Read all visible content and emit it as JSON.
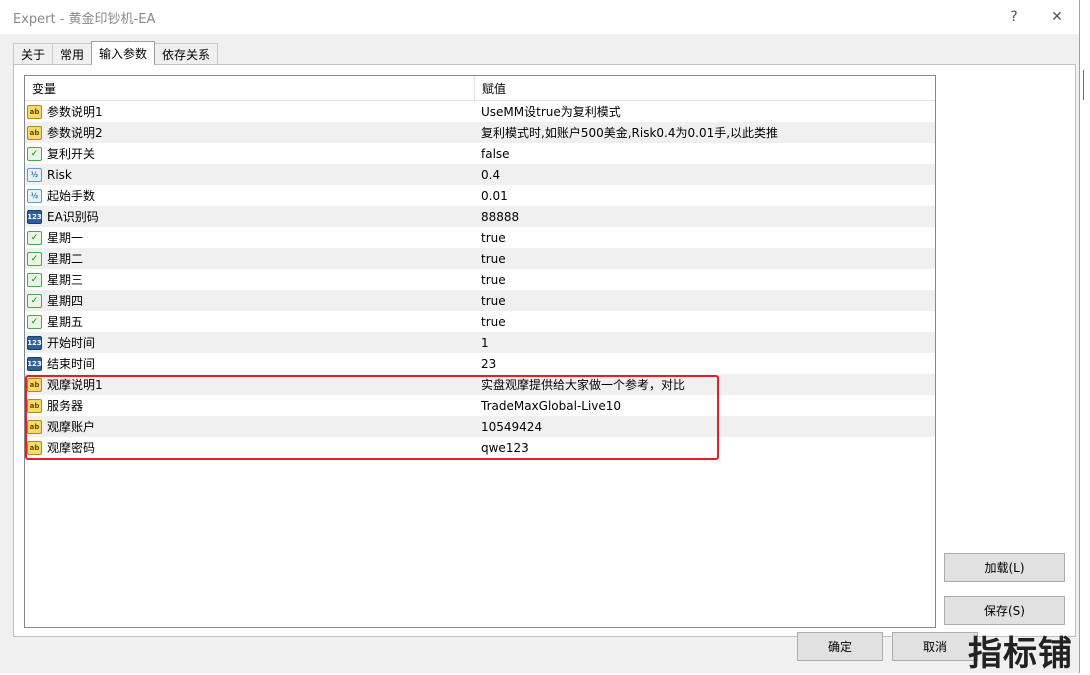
{
  "window": {
    "title": "Expert - 黄金印钞机-EA",
    "help_glyph": "?",
    "close_glyph": "✕"
  },
  "tabs": [
    {
      "label": "关于",
      "active": false
    },
    {
      "label": "常用",
      "active": false
    },
    {
      "label": "输入参数",
      "active": true
    },
    {
      "label": "依存关系",
      "active": false
    }
  ],
  "grid": {
    "headers": {
      "variable": "变量",
      "value": "赋值"
    },
    "rows": [
      {
        "icon": "ab",
        "name": "参数说明1",
        "value": "UseMM设true为复利模式"
      },
      {
        "icon": "ab",
        "name": "参数说明2",
        "value": "复利模式时,如账户500美金,Risk0.4为0.01手,以此类推"
      },
      {
        "icon": "bool",
        "name": "复利开关",
        "value": "false"
      },
      {
        "icon": "dbl",
        "name": "Risk",
        "value": "0.4"
      },
      {
        "icon": "dbl",
        "name": "起始手数",
        "value": "0.01"
      },
      {
        "icon": "int",
        "name": "EA识别码",
        "value": "88888"
      },
      {
        "icon": "bool",
        "name": "星期一",
        "value": "true"
      },
      {
        "icon": "bool",
        "name": "星期二",
        "value": "true"
      },
      {
        "icon": "bool",
        "name": "星期三",
        "value": "true"
      },
      {
        "icon": "bool",
        "name": "星期四",
        "value": "true"
      },
      {
        "icon": "bool",
        "name": "星期五",
        "value": "true"
      },
      {
        "icon": "int",
        "name": "开始时间",
        "value": "1"
      },
      {
        "icon": "int",
        "name": "结束时间",
        "value": "23"
      },
      {
        "icon": "ab",
        "name": "观摩说明1",
        "value": "实盘观摩提供给大家做一个参考，对比"
      },
      {
        "icon": "ab",
        "name": "服务器",
        "value": "TradeMaxGlobal-Live10"
      },
      {
        "icon": "ab",
        "name": "观摩账户",
        "value": "10549424"
      },
      {
        "icon": "ab",
        "name": "观摩密码",
        "value": "qwe123"
      }
    ]
  },
  "icons": {
    "ab": "ab",
    "bool": "✓",
    "dbl": "½",
    "int": "123"
  },
  "buttons": {
    "load": "加载(L)",
    "save": "保存(S)",
    "ok": "确定",
    "cancel": "取消"
  },
  "watermark": "指标铺",
  "highlight_color": "#e3202a"
}
